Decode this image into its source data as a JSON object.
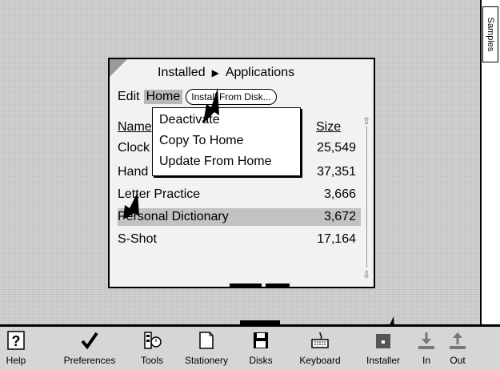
{
  "side_tab": {
    "label": "Samples"
  },
  "window": {
    "title_left": "Installed",
    "title_right": "Applications",
    "menu": {
      "edit": "Edit",
      "home": "Home"
    },
    "install_button": "Install From Disk...",
    "columns": {
      "name": "Name",
      "size": "Size"
    },
    "rows": [
      {
        "name": "Clock",
        "size": "25,549"
      },
      {
        "name": "Hand",
        "size": "37,351"
      },
      {
        "name": "Letter Practice",
        "size": "3,666"
      },
      {
        "name": "Personal Dictionary",
        "size": "3,672",
        "selected": true
      },
      {
        "name": "S-Shot",
        "size": "17,164"
      }
    ]
  },
  "home_menu": {
    "items": [
      "Deactivate",
      "Copy To Home",
      "Update From Home"
    ]
  },
  "dock": {
    "items": [
      {
        "label": "Help",
        "icon": "question-icon"
      },
      {
        "label": "Preferences",
        "icon": "checkmark-icon"
      },
      {
        "label": "Tools",
        "icon": "tools-icon"
      },
      {
        "label": "Stationery",
        "icon": "stationery-icon"
      },
      {
        "label": "Disks",
        "icon": "disk-icon"
      },
      {
        "label": "Keyboard",
        "icon": "keyboard-icon"
      },
      {
        "label": "Installer",
        "icon": "installer-icon"
      },
      {
        "label": "In",
        "icon": "in-tray-icon"
      },
      {
        "label": "Out",
        "icon": "out-tray-icon"
      }
    ]
  }
}
